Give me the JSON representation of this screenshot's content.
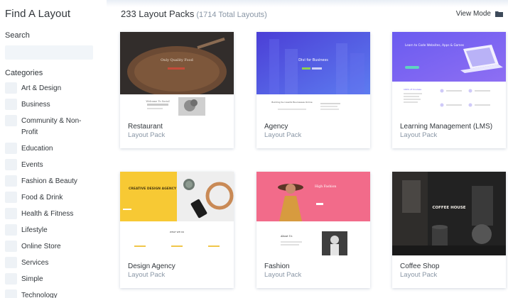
{
  "sidebar": {
    "title": "Find A Layout",
    "search_label": "Search",
    "search_value": "",
    "categories_label": "Categories",
    "categories": [
      "Art & Design",
      "Business",
      "Community & Non-Profit",
      "Education",
      "Events",
      "Fashion & Beauty",
      "Food & Drink",
      "Health & Fitness",
      "Lifestyle",
      "Online Store",
      "Services",
      "Simple",
      "Technology"
    ]
  },
  "header": {
    "packs_title": "233 Layout Packs",
    "packs_count": "(1714 Total Layouts)",
    "view_mode_label": "View Mode",
    "view_mode_icon": "folder-icon"
  },
  "packs": [
    {
      "name": "Restaurant",
      "type": "Layout Pack",
      "thumb_text": [
        "Only Quality Food",
        "Welcome To Social"
      ],
      "accent": "#c0392b"
    },
    {
      "name": "Agency",
      "type": "Layout Pack",
      "thumb_text": [
        "Divi for Business",
        "Building Successful Businesses Online"
      ],
      "accent": "#5b5be6"
    },
    {
      "name": "Learning Management (LMS)",
      "type": "Layout Pack",
      "thumb_text": [
        "Learn to Code Websites, Apps & Games",
        "100's of Courses"
      ],
      "accent": "#6d63f3"
    },
    {
      "name": "Design Agency",
      "type": "Layout Pack",
      "thumb_text": [
        "CREATIVE DESIGN AGENCY",
        "WHAT WE DO"
      ],
      "accent": "#f5c63a"
    },
    {
      "name": "Fashion",
      "type": "Layout Pack",
      "thumb_text": [
        "High Fashion",
        "About Us"
      ],
      "accent": "#f5738f"
    },
    {
      "name": "Coffee Shop",
      "type": "Layout Pack",
      "thumb_text": [
        "COFFEE HOUSE"
      ],
      "accent": "#2d2d2d"
    }
  ]
}
